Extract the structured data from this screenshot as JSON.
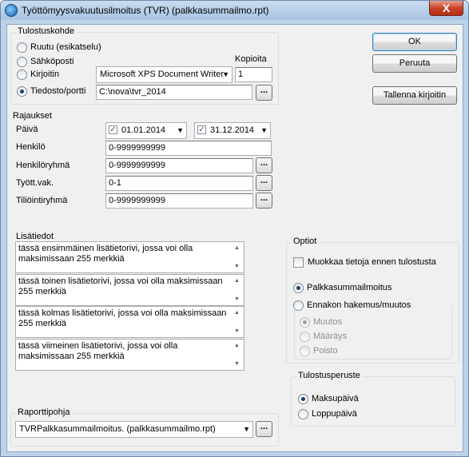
{
  "window": {
    "title": "Työttömyysvakuutusilmoitus (TVR) (palkkasummailmo.rpt)",
    "close": "X"
  },
  "tulostuskohde": {
    "title": "Tulostuskohde",
    "options": [
      "Ruutu (esikatselu)",
      "Sähköposti",
      "Kirjoitin",
      "Tiedosto/portti"
    ],
    "selected": "Tiedosto/portti",
    "printer": "Microsoft XPS Document Writer",
    "copies_label": "Kopioita",
    "copies": "1",
    "file_path": "C:\\nova\\tvr_2014",
    "browse": "..."
  },
  "rajaukset": {
    "title": "Rajaukset",
    "paiva_label": "Päivä",
    "date_from": "01.01.2014",
    "date_to": "31.12.2014",
    "henkilo_label": "Henkilö",
    "henkilo": "0-9999999999",
    "henkiloryhma_label": "Henkilöryhmä",
    "henkiloryhma": "0-9999999999",
    "tyottvak_label": "Tyött.vak.",
    "tyottvak": "0-1",
    "tiliointiryhma_label": "Tiliöintiryhmä",
    "tiliointiryhma": "0-9999999999",
    "browse": "...",
    "check": "✓"
  },
  "lisatiedot": {
    "title": "Lisätiedot",
    "rows": [
      "tässä ensimmäinen lisätietorivi, jossa voi olla maksimissaan 255 merkkiä",
      "tässä toinen  lisätietorivi, jossa voi olla maksimissaan 255 merkkiä",
      "tässä kolmas lisätietorivi, jossa voi olla maksimissaan 255 merkkiä",
      "tässä viimeinen lisätietorivi, jossa voi olla maksimissaan 255 merkkiä"
    ]
  },
  "raporttipohja": {
    "title": "Raporttipohja",
    "value": "TVRPalkkasummailmoitus. (palkkasummailmo.rpt)",
    "browse": "..."
  },
  "buttons": {
    "ok": "OK",
    "cancel": "Peruuta",
    "save_printer": "Tallenna kirjoitin"
  },
  "optiot": {
    "title": "Optiot",
    "edit_before_print": "Muokkaa tietoja ennen tulostusta",
    "report_type": [
      "Palkkasummailmoitus",
      "Ennakon hakemus/muutos"
    ],
    "report_selected": "Palkkasummailmoitus",
    "sub_options": [
      "Muutos",
      "Määräys",
      "Poisto"
    ],
    "sub_selected": "Muutos"
  },
  "tulostusperuste": {
    "title": "Tulostusperuste",
    "options": [
      "Maksupäivä",
      "Loppupäivä"
    ],
    "selected": "Maksupäivä"
  }
}
